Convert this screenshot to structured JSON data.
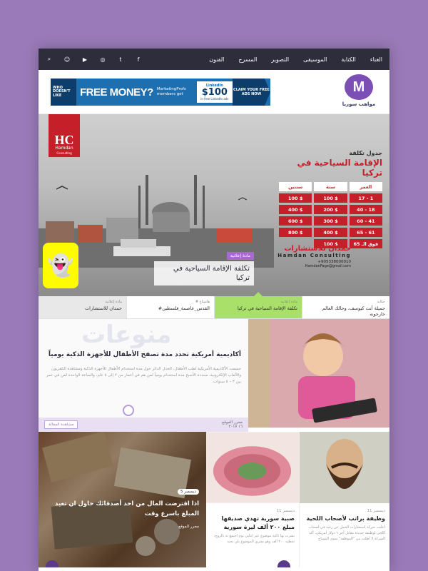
{
  "nav": {
    "menu": [
      "الغناء",
      "الكتابة",
      "الموسيقى",
      "التصوير",
      "المسرح",
      "الفنون"
    ],
    "icons": [
      {
        "name": "facebook-icon",
        "glyph": "f"
      },
      {
        "name": "twitter-icon",
        "glyph": "t"
      },
      {
        "name": "instagram-icon",
        "glyph": "◎"
      },
      {
        "name": "youtube-icon",
        "glyph": "▶"
      },
      {
        "name": "snapchat-icon",
        "glyph": "☺"
      },
      {
        "name": "search-icon",
        "glyph": "⌕"
      }
    ]
  },
  "header": {
    "logo_text": "مواهب سوريا",
    "ad": {
      "who": "WHO DOESN'T LIKE",
      "free_money": "FREE MONEY?",
      "marketingprofs": "MarketingProfs members get",
      "linkedin": "LinkedIn",
      "amount": "$100",
      "amount_sub": "in free LinkedIn ads",
      "cta": "CLAIM YOUR FREE ADS NOW"
    }
  },
  "hero": {
    "company_short": "HC",
    "company_name": "Hamdan",
    "company_sub": "Consulting",
    "pricing_line1": "جدول تكلفة",
    "pricing_line2": "الإقامة السياحية في تركيا",
    "pricing_headers": [
      "العمر",
      "سنة",
      "سنتين"
    ],
    "pricing_rows": [
      [
        "1 - 17",
        "$ 100",
        "$ 100"
      ],
      [
        "18 - 40",
        "$ 200",
        "$ 400"
      ],
      [
        "41 - 60",
        "$ 300",
        "$ 600"
      ],
      [
        "61 - 65",
        "$ 400",
        "$ 800"
      ],
      [
        "فوق الـ 65",
        "$ 100",
        ""
      ]
    ],
    "brand_ar": "حمدان للاستشارات",
    "brand_en": "Hamdan Consulting",
    "phone": "+905338000010",
    "email": "HamdanPage@gmail.com",
    "tag": "مادة إعلانية",
    "caption": "تكلفة الإقامة السياحية في تركيا"
  },
  "tabs": [
    {
      "cat": "حكاية",
      "title": "جميلة أنت كيوسف، وحالك العالم خارجونه"
    },
    {
      "cat": "مادة إعلانية",
      "title": "تكلفة الإقامة السياحية في تركيا"
    },
    {
      "cat": "هاشتاغ #",
      "title": "القدس_عاصمة_فلسطين#"
    },
    {
      "cat": "مادة إعلانية",
      "title": "حمدان للاستشارات"
    }
  ],
  "feature": {
    "section": "منوعات",
    "title": "أكاديمية أمريكية تحدد مدة تصفح الأطفال للأجهزة الذكية يومياً",
    "excerpt": "حسمت الأكاديمية الأمريكية لطب الأطفال، الجدل الدائر حول مدة استخدام الأطفال للأجهزة الذكية ومشاهدة التلفزيون والألعاب الإلكترونية، محددة الأصبح مدة استخدام يومياً لمن هم في أعمار من ٢ إلى ٥ عام، والساعة الواحدة لمن في عمر بين ٣ – ٥ سنوات.",
    "author": "محرر الموقع",
    "date": "١٦ ٢٠١٧",
    "more": "مشاهدة المقالة"
  },
  "cards": {
    "money": {
      "date": "ديسمبر 5",
      "title": "اذا اقترضت المال من احد أصدقائك حاول ان تعيد المبلغ باسرع وقت",
      "author": "محرر الموقع"
    },
    "flowers": {
      "date": "ديسمبر 11",
      "title": "صبية سورية تهدي صديقها مبلغ ٢٠٠ ألف ليرة سورية",
      "excerpt": "نشرت بها تاكتة موضوع عبر انتابي يوم اجتمع بة بالزوج، تحطيه ٢٠٠ ألف وهو يشري الموضوع بلي بحبه"
    },
    "beard": {
      "date": "ديسمبر 11",
      "title": "وظيفة براتب لأصحاب اللحية",
      "excerpt": "أعلنت شركة استشارات الحمل عن رغبة في أصحاب اللحى لوظيفة جديدة مقابل أجر ٦ دولار أمريكي. أكد الشركة لا أطلب من \"الموظفة\" سوى المساح"
    }
  }
}
